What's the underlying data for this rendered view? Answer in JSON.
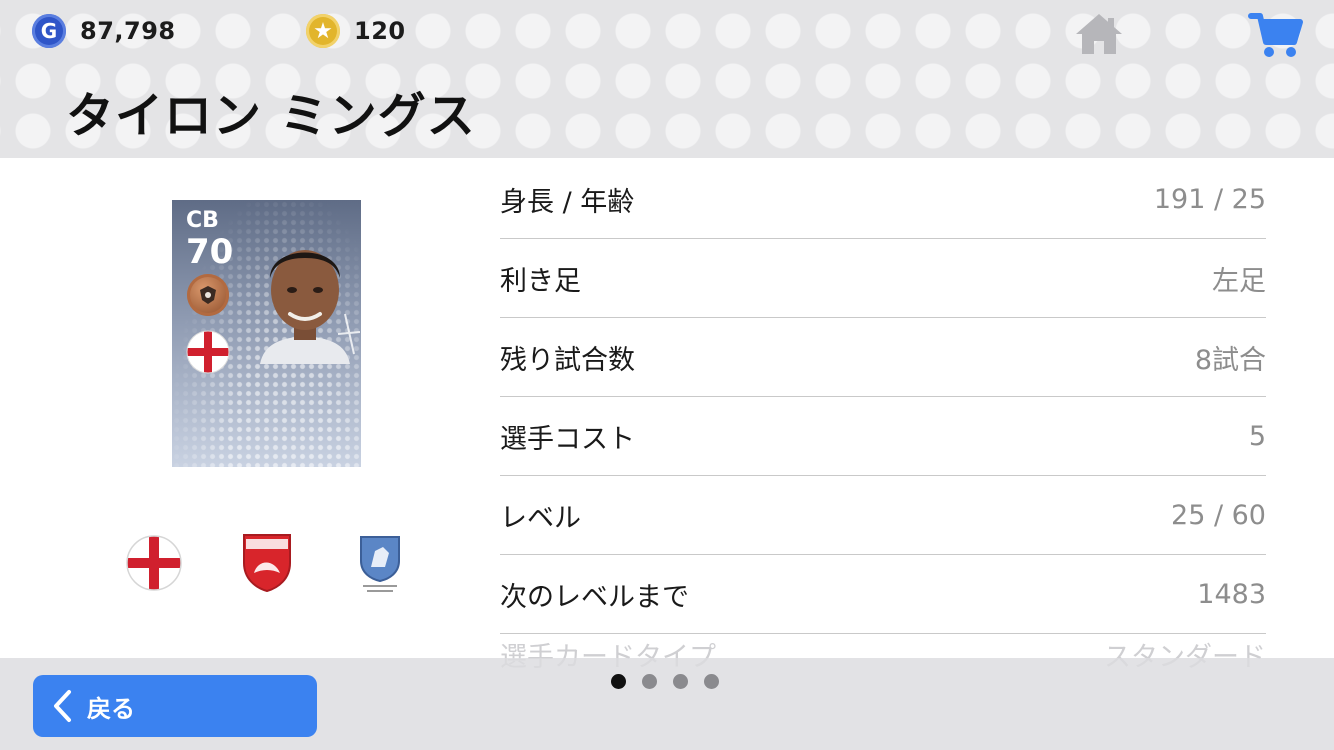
{
  "header": {
    "gp": {
      "icon": "gp-coin-icon",
      "icon_letter": "G",
      "value": "87,798",
      "color": "#2f55c8"
    },
    "coins": {
      "icon": "star-coin-icon",
      "value": "120",
      "color": "#e2b52c"
    },
    "home_icon": "home-icon",
    "cart_icon": "cart-icon",
    "accent_color": "#3b82f0",
    "player_name": "タイロン ミングス"
  },
  "card": {
    "position": "CB",
    "rating": "70",
    "medal_icon": "bronze-medal-icon",
    "nationality_icon": "england-flag-icon",
    "portrait": "player-portrait"
  },
  "badges": [
    "england-flag-icon",
    "club-crest-icon",
    "league-emblem-icon"
  ],
  "info": {
    "rows": [
      {
        "label": "身長 / 年齢",
        "value": "191 / 25"
      },
      {
        "label": "利き足",
        "value": "左足"
      },
      {
        "label": "残り試合数",
        "value": "8試合"
      },
      {
        "label": "選手コスト",
        "value": "5"
      },
      {
        "label": "レベル",
        "value": "25 / 60"
      },
      {
        "label": "次のレベルまで",
        "value": "1483"
      },
      {
        "label": "選手カードタイプ",
        "value": "スタンダード"
      }
    ]
  },
  "footer": {
    "back_label": "戻る",
    "back_icon": "chevron-left-icon",
    "pager": {
      "total": 4,
      "current": 1
    }
  }
}
